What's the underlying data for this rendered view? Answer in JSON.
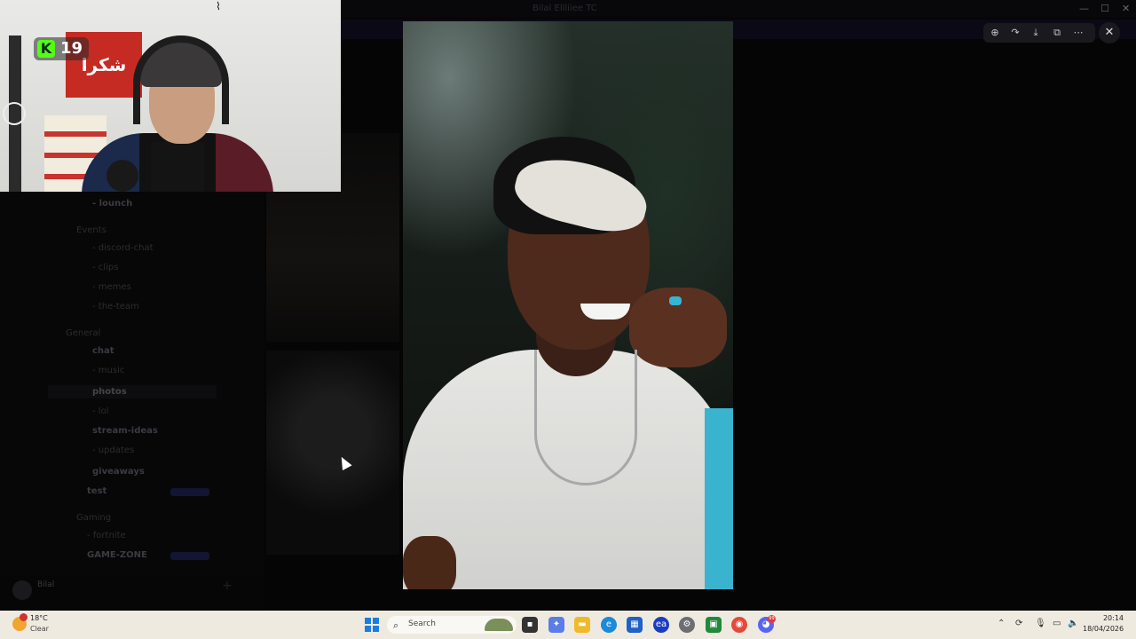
{
  "window": {
    "title": "Bilal Ellliiee TC"
  },
  "sidebar": {
    "channels": [
      {
        "label": "- lounch",
        "bold": true
      },
      {
        "label": "Events",
        "bold": false
      },
      {
        "label": "- discord-chat",
        "bold": false
      },
      {
        "label": "- clips",
        "bold": false
      },
      {
        "label": "- memes",
        "bold": false
      },
      {
        "label": "- the-team",
        "bold": false
      },
      {
        "label": "General",
        "bold": false
      },
      {
        "label": "chat",
        "bold": true
      },
      {
        "label": "- music",
        "bold": false
      },
      {
        "label": "photos",
        "bold": true
      },
      {
        "label": "- lol",
        "bold": false
      },
      {
        "label": "stream-ideas",
        "bold": true
      },
      {
        "label": "- updates",
        "bold": false
      },
      {
        "label": "giveaways",
        "bold": true
      },
      {
        "label": "test",
        "bold": true
      },
      {
        "label": "Gaming",
        "bold": false
      },
      {
        "label": "- fortnite",
        "bold": false
      },
      {
        "label": "GAME-ZONE",
        "bold": true
      }
    ],
    "user": {
      "name": "Bilal"
    }
  },
  "webcam": {
    "badge_count": "19",
    "badge_letter": "K",
    "sign_text": "شكرا"
  },
  "viewer": {
    "tools": [
      "zoom-in-icon",
      "forward-icon",
      "download-icon",
      "open-external-icon",
      "more-icon"
    ],
    "close_label": "✕"
  },
  "taskbar": {
    "weather_temp": "18°C",
    "weather_condition": "Clear",
    "weather_badge": "1",
    "search_placeholder": "Search",
    "apps": [
      "file-explorer-icon",
      "copilot-icon",
      "folder-icon",
      "edge-icon",
      "store-icon",
      "ea-icon",
      "settings-icon",
      "xbox-icon",
      "chrome-icon",
      "discord-icon"
    ],
    "discord_badge": "99",
    "time": "20:14",
    "date": "18/04/2026"
  }
}
